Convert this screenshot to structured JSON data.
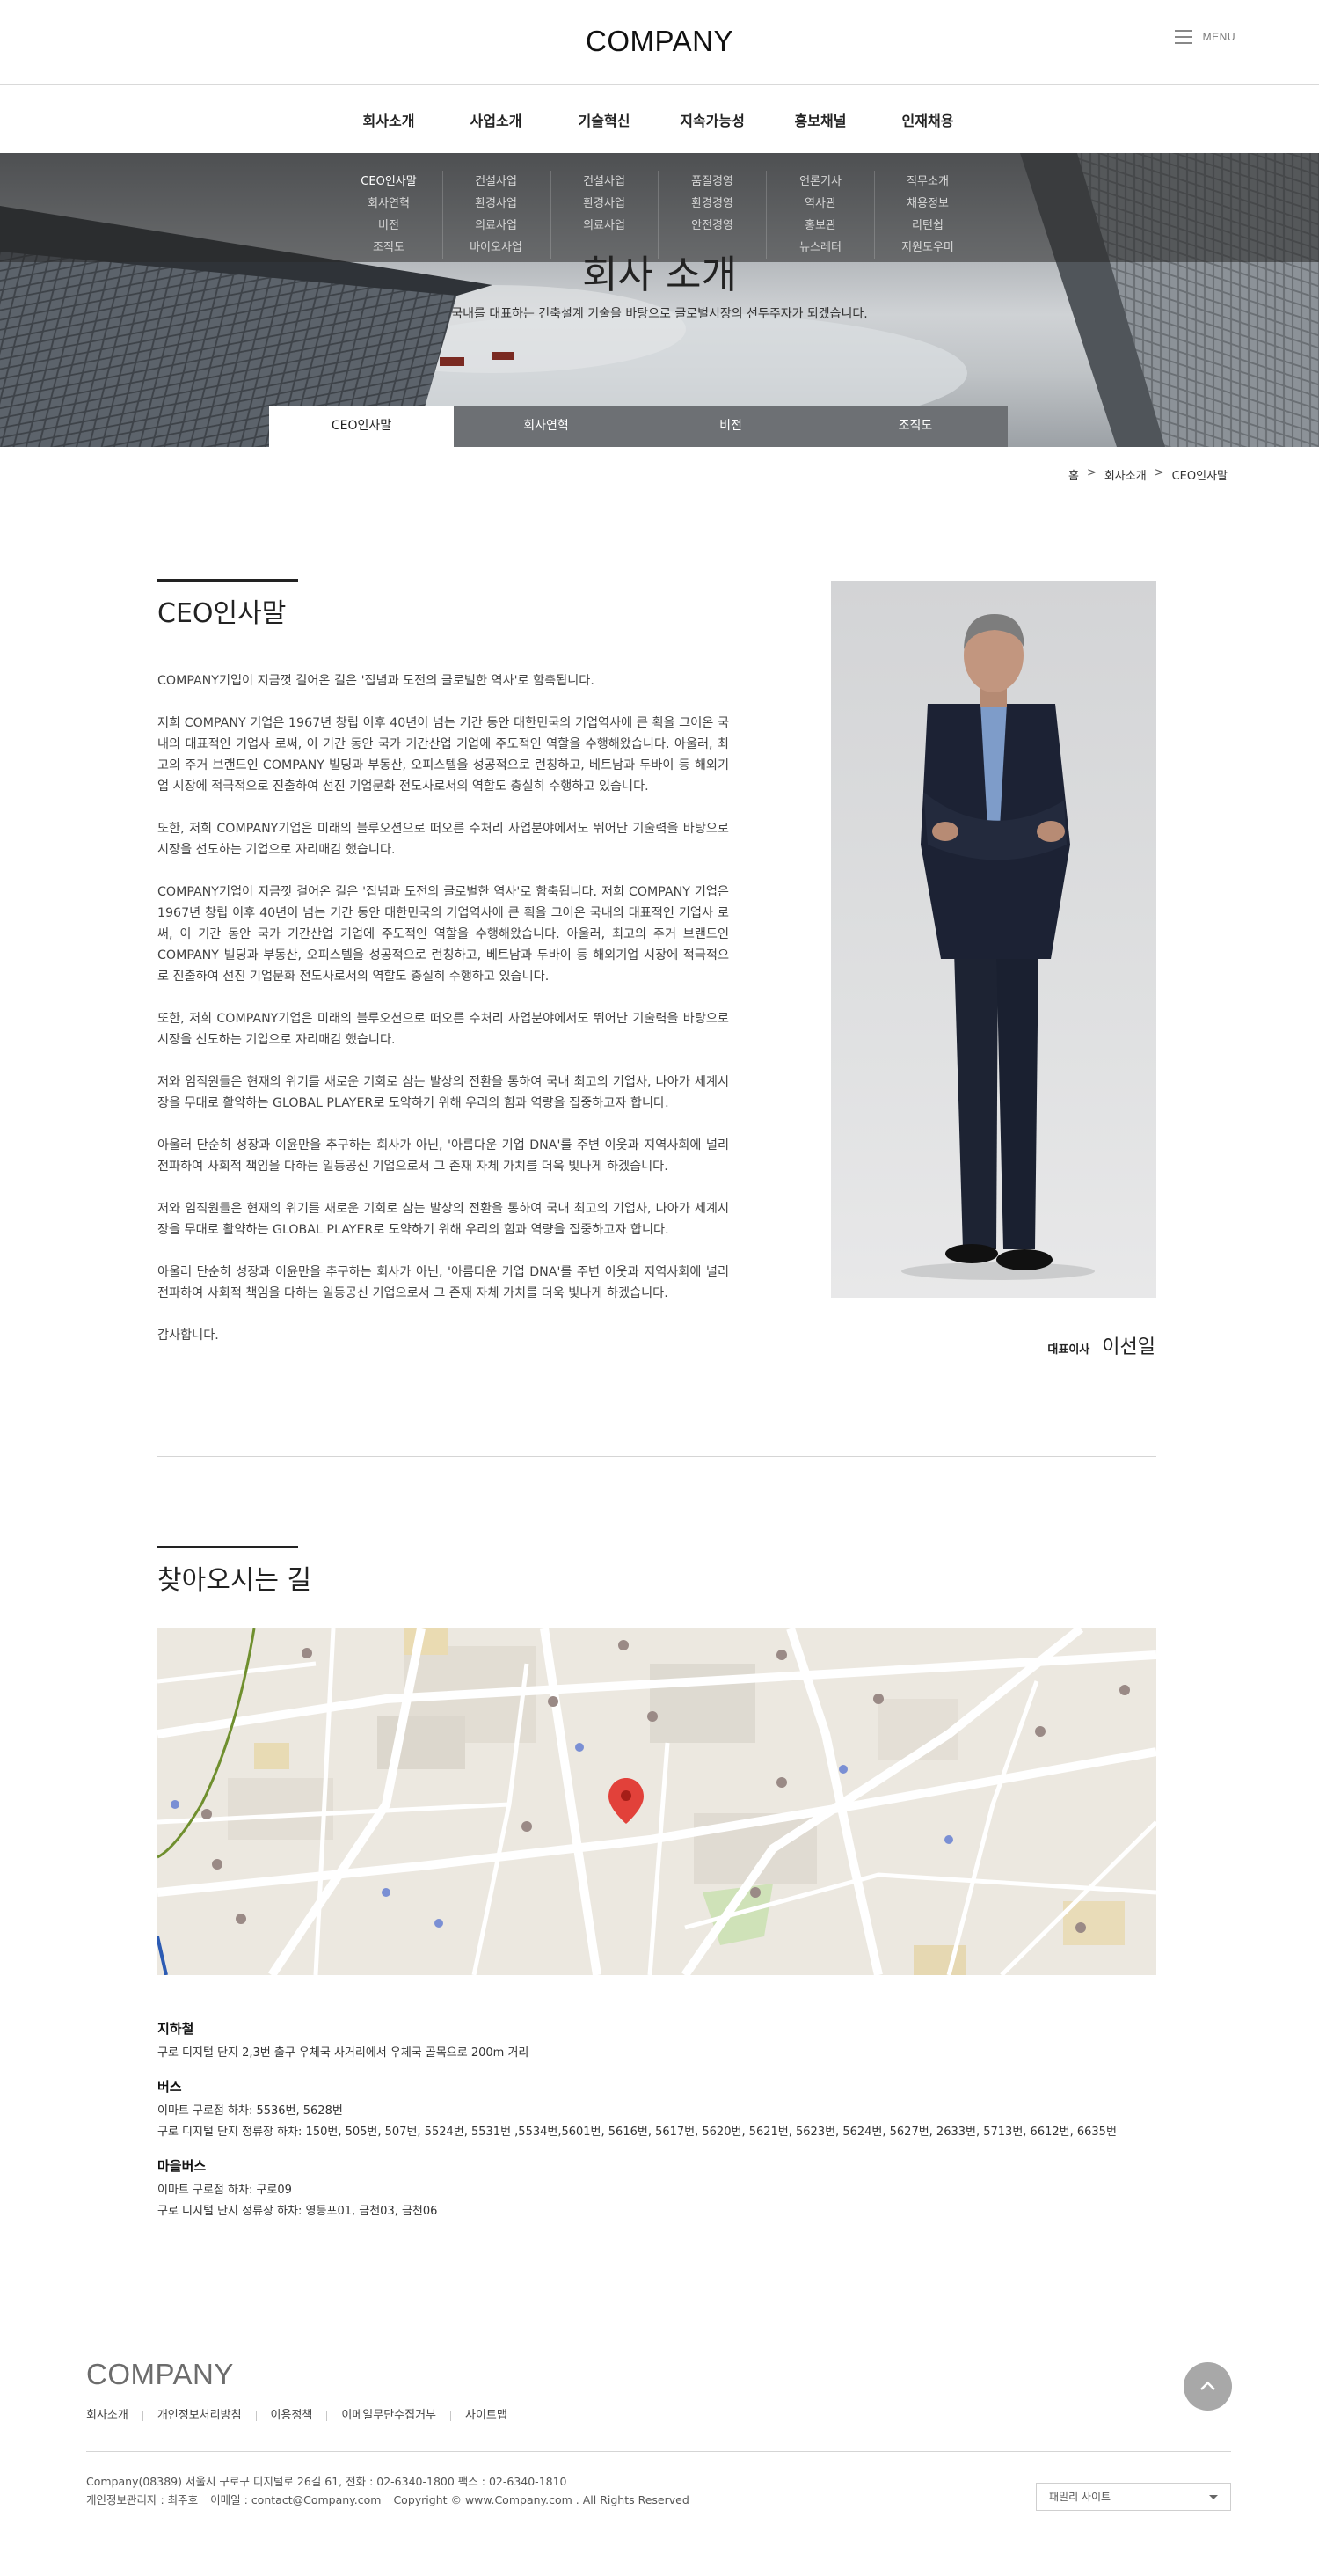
{
  "header": {
    "logo": "COMPANY",
    "menu_label": "MENU"
  },
  "gnb": [
    {
      "label": "회사소개",
      "sub": [
        "CEO인사말",
        "회사연혁",
        "비전",
        "조직도"
      ]
    },
    {
      "label": "사업소개",
      "sub": [
        "건설사업",
        "환경사업",
        "의료사업",
        "바이오사업"
      ]
    },
    {
      "label": "기술혁신",
      "sub": [
        "건설사업",
        "환경사업",
        "의료사업"
      ]
    },
    {
      "label": "지속가능성",
      "sub": [
        "품질경영",
        "환경경영",
        "안전경영"
      ]
    },
    {
      "label": "홍보채널",
      "sub": [
        "언론기사",
        "역사관",
        "홍보관",
        "뉴스레터"
      ]
    },
    {
      "label": "인재채용",
      "sub": [
        "직무소개",
        "채용정보",
        "리턴쉽",
        "지원도우미"
      ]
    }
  ],
  "hero": {
    "title": "회사 소개",
    "subtitle": "국내를 대표하는 건축설계 기술을 바탕으로 글로벌시장의 선두주자가 되겠습니다."
  },
  "subtabs": [
    "CEO인사말",
    "회사연혁",
    "비전",
    "조직도"
  ],
  "breadcrumb": {
    "home": "홈",
    "sep": ">",
    "level1": "회사소개",
    "level2": "CEO인사말"
  },
  "ceo": {
    "title": "CEO인사말",
    "paragraphs": [
      "COMPANY기업이 지금껏 걸어온 길은 '집념과 도전의 글로벌한 역사'로 함축됩니다.",
      "저희 COMPANY 기업은 1967년 창립 이후 40년이 넘는 기간 동안 대한민국의 기업역사에 큰 획을 그어온 국내의 대표적인 기업사 로써, 이 기간 동안 국가 기간산업 기업에 주도적인 역할을 수행해왔습니다. 아울러, 최고의 주거 브랜드인 COMPANY 빌딩과 부동산, 오피스텔을 성공적으로 런칭하고, 베트남과 두바이 등 해외기업 시장에 적극적으로 진출하여 선진 기업문화 전도사로서의 역할도 충실히 수행하고 있습니다.",
      "또한, 저희 COMPANY기업은 미래의 블루오션으로 떠오른 수처리 사업분야에서도 뛰어난 기술력을 바탕으로 시장을 선도하는 기업으로 자리매김 했습니다.",
      "COMPANY기업이 지금껏 걸어온 길은 '집념과 도전의 글로벌한 역사'로 함축됩니다. 저희 COMPANY 기업은 1967년 창립 이후 40년이 넘는 기간 동안 대한민국의 기업역사에 큰 획을 그어온 국내의 대표적인 기업사 로써, 이 기간 동안 국가 기간산업 기업에 주도적인 역할을 수행해왔습니다. 아울러, 최고의 주거 브랜드인 COMPANY 빌딩과 부동산, 오피스텔을 성공적으로 런칭하고, 베트남과 두바이 등 해외기업 시장에 적극적으로 진출하여 선진 기업문화 전도사로서의 역할도 충실히 수행하고 있습니다.",
      "또한, 저희 COMPANY기업은 미래의 블루오션으로 떠오른 수처리 사업분야에서도 뛰어난 기술력을 바탕으로 시장을 선도하는 기업으로 자리매김 했습니다.",
      "저와 임직원들은 현재의 위기를 새로운 기회로 삼는 발상의 전환을 통하여 국내 최고의 기업사, 나아가 세계시장을 무대로 활약하는 GLOBAL PLAYER로 도약하기 위해 우리의 힘과 역량을 집중하고자 합니다.",
      "아울러 단순히 성장과 이윤만을 추구하는 회사가 아닌, '아름다운 기업 DNA'를 주변 이웃과 지역사회에 널리 전파하여 사회적 책임을 다하는 일등공신 기업으로서 그 존재 자체 가치를 더욱 빛나게 하겠습니다.",
      "저와 임직원들은 현재의 위기를 새로운 기회로 삼는 발상의 전환을 통하여 국내 최고의 기업사, 나아가 세계시장을 무대로 활약하는 GLOBAL PLAYER로 도약하기 위해 우리의 힘과 역량을 집중하고자 합니다.",
      "아울러 단순히 성장과 이윤만을 추구하는 회사가 아닌, '아름다운 기업 DNA'를 주변 이웃과 지역사회에 널리 전파하여 사회적 책임을 다하는 일등공신 기업으로서 그 존재 자체 가치를 더욱 빛나게 하겠습니다.",
      "감사합니다."
    ],
    "position": "대표이사",
    "name": "이선일"
  },
  "location": {
    "title": "찾아오시는 길",
    "subway": {
      "title": "지하철",
      "lines": [
        "구로 디지털 단지 2,3번 출구 우체국 사거리에서 우체국 골목으로 200m 거리"
      ]
    },
    "bus": {
      "title": "버스",
      "lines": [
        "이마트 구로점 하차: 5536번, 5628번",
        "구로 디지털 단지 정류장 하차: 150번, 505번, 507번, 5524번, 5531번 ,5534번,5601번, 5616번, 5617번, 5620번, 5621번, 5623번, 5624번, 5627번, 2633번, 5713번, 6612번, 6635번"
      ]
    },
    "village_bus": {
      "title": "마을버스",
      "lines": [
        "이마트 구로점 하차: 구로09",
        "구로 디지털 단지 정류장 하차: 영등포01, 금천03, 금천06"
      ]
    }
  },
  "footer": {
    "logo": "COMPANY",
    "links": [
      "회사소개",
      "개인정보처리방침",
      "이용정책",
      "이메일무단수집거부",
      "사이트맵"
    ],
    "address": "Company(08389) 서울시 구로구 디지털로 26길 61, 전화 : 02-6340-1800 팩스 : 02-6340-1810",
    "manager": "개인정보관리자 : 최주호",
    "email": "이메일 : contact@Company.com",
    "copyright": "Copyright © www.Company.com . All Rights Reserved",
    "family_site": "패밀리 사이트"
  },
  "colors": {
    "tab_inactive": "#6d7074",
    "dropdown_overlay": "rgba(40,40,40,0.55)",
    "map_pin": "#e2413a"
  },
  "icons": {
    "menu": "hamburger-icon",
    "top": "chevron-up-icon",
    "map_pin": "map-pin-icon",
    "select": "caret-down-icon"
  }
}
